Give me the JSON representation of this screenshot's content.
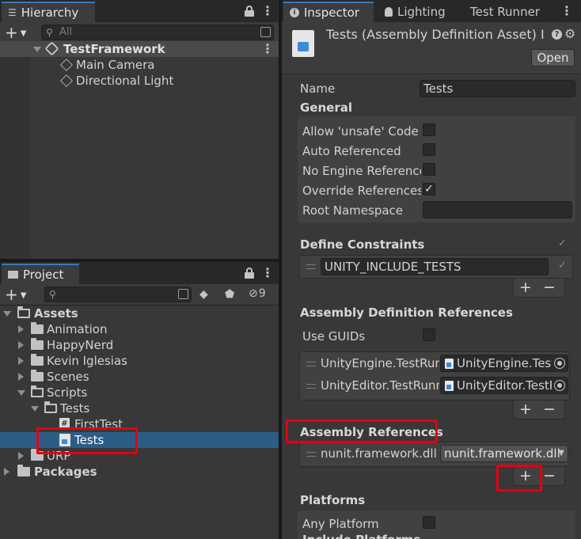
{
  "hierarchy": {
    "tab_label": "Hierarchy",
    "search_placeholder": "All",
    "scene_name": "TestFramework",
    "objects": [
      "Main Camera",
      "Directional Light"
    ]
  },
  "project": {
    "tab_label": "Project",
    "hidden_count": "9",
    "tree": {
      "assets": "Assets",
      "animation": "Animation",
      "happynerd": "HappyNerd",
      "kevin": "Kevin Iglesias",
      "scenes": "Scenes",
      "scripts": "Scripts",
      "tests_folder": "Tests",
      "firsttest": "FirstTest",
      "tests_asset": "Tests",
      "urp": "URP",
      "packages": "Packages"
    }
  },
  "inspector": {
    "tabs": [
      "Inspector",
      "Lighting",
      "Test Runner"
    ],
    "header_title": "Tests (Assembly Definition Asset) I",
    "open_button": "Open",
    "name_label": "Name",
    "name_value": "Tests",
    "general_label": "General",
    "general_fields": [
      {
        "label": "Allow 'unsafe' Code",
        "checked": false
      },
      {
        "label": "Auto Referenced",
        "checked": false
      },
      {
        "label": "No Engine References",
        "checked": false
      },
      {
        "label": "Override References",
        "checked": true
      }
    ],
    "root_namespace_label": "Root Namespace",
    "root_namespace_value": "",
    "define_constraints_label": "Define Constraints",
    "define_constraint_value": "UNITY_INCLUDE_TESTS",
    "asmdef_refs_label": "Assembly Definition References",
    "use_guids_label": "Use GUIDs",
    "asmdef_refs": [
      {
        "name": "UnityEngine.TestRunner",
        "object": "UnityEngine.TestRunner"
      },
      {
        "name": "UnityEditor.TestRunner",
        "object": "UnityEditor.TestRunner"
      }
    ],
    "assembly_refs_label": "Assembly References",
    "assembly_ref_name": "nunit.framework.dll",
    "assembly_ref_dropdown": "nunit.framework.dll",
    "platforms_label": "Platforms",
    "any_platform_label": "Any Platform",
    "include_platforms_partial": "Include Platforms",
    "plus": "+",
    "minus": "−",
    "check": "✓",
    "kebab": "⋮"
  },
  "colors": {
    "highlight": "#e4000f",
    "selection": "#2c5d87",
    "tab_accent": "#3a79bb"
  }
}
